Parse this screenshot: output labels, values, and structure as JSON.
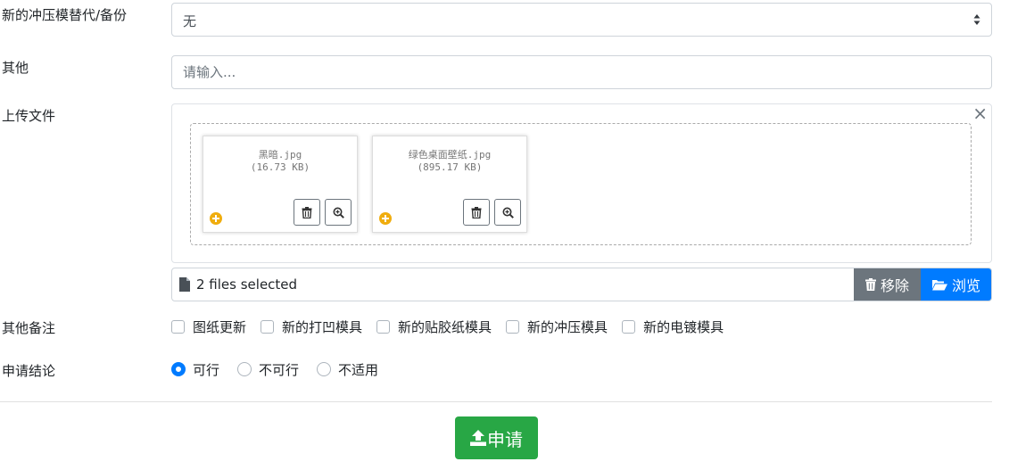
{
  "form": {
    "replacement_label": "新的冲压模替代/备份",
    "replacement_value": "无",
    "other_label": "其他",
    "other_placeholder": "请输入...",
    "upload_label": "上传文件",
    "notes_label": "其他备注",
    "conclusion_label": "申请结论"
  },
  "upload": {
    "close_glyph": "×",
    "files": [
      {
        "name": "黑暗.jpg",
        "size": "(16.73 KB)"
      },
      {
        "name": "绿色桌面壁纸.jpg",
        "size": "(895.17 KB)"
      }
    ],
    "caption": "2 files selected",
    "remove_label": "移除",
    "browse_label": "浏览"
  },
  "notes_options": [
    {
      "label": "图纸更新",
      "checked": false
    },
    {
      "label": "新的打凹模具",
      "checked": false
    },
    {
      "label": "新的贴胶纸模具",
      "checked": false
    },
    {
      "label": "新的冲压模具",
      "checked": false
    },
    {
      "label": "新的电镀模具",
      "checked": false
    }
  ],
  "conclusion_options": [
    {
      "label": "可行",
      "selected": true
    },
    {
      "label": "不可行",
      "selected": false
    },
    {
      "label": "不适用",
      "selected": false
    }
  ],
  "submit_label": "申请",
  "colors": {
    "primary": "#007bff",
    "success": "#28a745",
    "secondary": "#6c757d",
    "plus_icon": "#f0ad0e"
  }
}
